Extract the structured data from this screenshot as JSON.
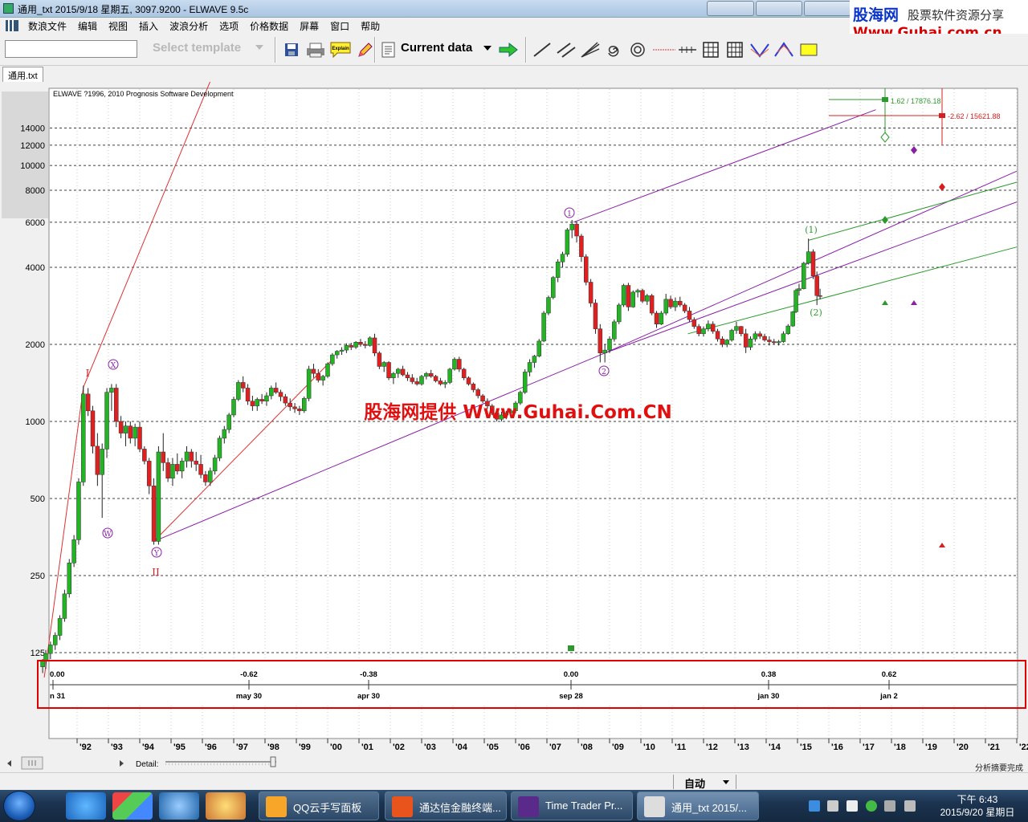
{
  "window": {
    "title": "通用_txt  2015/9/18 星期五, 3097.9200 - ELWAVE 9.5c"
  },
  "promo": {
    "logo": "股海网",
    "slogan": "股票软件资源分享",
    "url": "Www.Guhai.com.cn"
  },
  "menu": [
    "数浪文件",
    "编辑",
    "视图",
    "插入",
    "波浪分析",
    "选项",
    "价格数据",
    "屏幕",
    "窗口",
    "帮助"
  ],
  "toolbar": {
    "search_value": "",
    "template_label": "Select template",
    "explain_label": "Explain",
    "data_label": "Current data"
  },
  "document_tab": "通用.txt",
  "chart_data": {
    "type": "candlestick",
    "title": "ELWAVE ?1996, 2010 Prognosis Software Development",
    "watermark": "股海网提供 Www.Guhai.Com.CN",
    "y_scale": "log",
    "y_ticks": [
      125,
      250,
      500,
      1000,
      2000,
      4000,
      6000,
      8000,
      10000,
      12000,
      14000
    ],
    "x_ticks": [
      "'92",
      "'93",
      "'94",
      "'95",
      "'96",
      "'97",
      "'98",
      "'99",
      "'00",
      "'01",
      "'02",
      "'03",
      "'04",
      "'05",
      "'06",
      "'07",
      "'08",
      "'09",
      "'10",
      "'11",
      "'12",
      "'13",
      "'14",
      "'15",
      "'16",
      "'17",
      "'18",
      "'19",
      "'20",
      "'21",
      "'22"
    ],
    "candles": [
      [
        1990.9,
        110,
        118,
        104,
        116
      ],
      [
        1991.0,
        116,
        128,
        108,
        124
      ],
      [
        1991.15,
        124,
        138,
        118,
        134
      ],
      [
        1991.3,
        134,
        150,
        128,
        146
      ],
      [
        1991.45,
        146,
        175,
        140,
        170
      ],
      [
        1991.6,
        170,
        220,
        165,
        212
      ],
      [
        1991.75,
        212,
        290,
        205,
        280
      ],
      [
        1991.9,
        280,
        360,
        270,
        345
      ],
      [
        1992.05,
        345,
        600,
        330,
        580
      ],
      [
        1992.2,
        580,
        1380,
        560,
        1280
      ],
      [
        1992.35,
        1280,
        1350,
        1050,
        1100
      ],
      [
        1992.5,
        1100,
        1150,
        750,
        800
      ],
      [
        1992.65,
        800,
        900,
        560,
        620
      ],
      [
        1992.8,
        620,
        820,
        420,
        780
      ],
      [
        1992.95,
        780,
        1350,
        720,
        1300
      ],
      [
        1993.1,
        1300,
        1400,
        1100,
        1350
      ],
      [
        1993.25,
        1350,
        1400,
        950,
        1000
      ],
      [
        1993.4,
        1000,
        1050,
        860,
        900
      ],
      [
        1993.55,
        900,
        1000,
        800,
        960
      ],
      [
        1993.7,
        960,
        1000,
        820,
        860
      ],
      [
        1993.85,
        860,
        980,
        800,
        950
      ],
      [
        1994.0,
        950,
        1000,
        760,
        780
      ],
      [
        1994.15,
        780,
        800,
        680,
        700
      ],
      [
        1994.3,
        700,
        720,
        520,
        560
      ],
      [
        1994.45,
        560,
        600,
        330,
        340
      ],
      [
        1994.6,
        340,
        800,
        330,
        760
      ],
      [
        1994.75,
        760,
        900,
        640,
        690
      ],
      [
        1994.9,
        690,
        720,
        580,
        600
      ],
      [
        1995.05,
        600,
        720,
        560,
        680
      ],
      [
        1995.2,
        680,
        750,
        620,
        640
      ],
      [
        1995.35,
        640,
        720,
        600,
        700
      ],
      [
        1995.5,
        700,
        800,
        660,
        760
      ],
      [
        1995.65,
        760,
        780,
        660,
        700
      ],
      [
        1995.8,
        700,
        760,
        640,
        680
      ],
      [
        1995.95,
        680,
        740,
        600,
        620
      ],
      [
        1996.1,
        620,
        640,
        560,
        580
      ],
      [
        1996.25,
        580,
        660,
        560,
        640
      ],
      [
        1996.4,
        640,
        740,
        620,
        720
      ],
      [
        1996.55,
        720,
        880,
        700,
        860
      ],
      [
        1996.7,
        860,
        960,
        820,
        930
      ],
      [
        1996.85,
        930,
        1080,
        900,
        1060
      ],
      [
        1997.0,
        1060,
        1250,
        1040,
        1220
      ],
      [
        1997.15,
        1220,
        1450,
        1200,
        1420
      ],
      [
        1997.3,
        1420,
        1500,
        1300,
        1350
      ],
      [
        1997.45,
        1350,
        1400,
        1160,
        1200
      ],
      [
        1997.6,
        1200,
        1260,
        1100,
        1150
      ],
      [
        1997.75,
        1150,
        1240,
        1100,
        1220
      ],
      [
        1997.9,
        1220,
        1280,
        1170,
        1200
      ],
      [
        1998.05,
        1200,
        1300,
        1150,
        1260
      ],
      [
        1998.2,
        1260,
        1380,
        1220,
        1350
      ],
      [
        1998.35,
        1350,
        1420,
        1280,
        1300
      ],
      [
        1998.5,
        1300,
        1330,
        1200,
        1250
      ],
      [
        1998.65,
        1250,
        1280,
        1150,
        1180
      ],
      [
        1998.8,
        1180,
        1230,
        1100,
        1140
      ],
      [
        1998.95,
        1140,
        1180,
        1080,
        1120
      ],
      [
        1999.1,
        1120,
        1150,
        1060,
        1100
      ],
      [
        1999.25,
        1100,
        1250,
        1080,
        1230
      ],
      [
        1999.4,
        1230,
        1650,
        1200,
        1600
      ],
      [
        1999.55,
        1600,
        1680,
        1480,
        1540
      ],
      [
        1999.7,
        1540,
        1600,
        1420,
        1450
      ],
      [
        1999.85,
        1450,
        1520,
        1380,
        1500
      ],
      [
        2000.0,
        1500,
        1700,
        1480,
        1680
      ],
      [
        2000.15,
        1680,
        1850,
        1650,
        1820
      ],
      [
        2000.3,
        1820,
        1900,
        1760,
        1880
      ],
      [
        2000.45,
        1880,
        1950,
        1820,
        1900
      ],
      [
        2000.6,
        1900,
        2020,
        1850,
        1980
      ],
      [
        2000.75,
        1980,
        2030,
        1900,
        1950
      ],
      [
        2000.9,
        1950,
        2060,
        1920,
        2040
      ],
      [
        2001.05,
        2040,
        2100,
        1960,
        2000
      ],
      [
        2001.2,
        2000,
        2060,
        1930,
        1980
      ],
      [
        2001.35,
        1980,
        2150,
        1960,
        2120
      ],
      [
        2001.5,
        2120,
        2200,
        1800,
        1850
      ],
      [
        2001.65,
        1850,
        1880,
        1600,
        1640
      ],
      [
        2001.8,
        1640,
        1720,
        1560,
        1700
      ],
      [
        2001.95,
        1700,
        1720,
        1450,
        1480
      ],
      [
        2002.1,
        1480,
        1560,
        1400,
        1540
      ],
      [
        2002.25,
        1540,
        1620,
        1480,
        1600
      ],
      [
        2002.4,
        1600,
        1650,
        1500,
        1520
      ],
      [
        2002.55,
        1520,
        1560,
        1440,
        1480
      ],
      [
        2002.7,
        1480,
        1530,
        1400,
        1430
      ],
      [
        2002.85,
        1430,
        1480,
        1380,
        1400
      ],
      [
        2003.0,
        1400,
        1520,
        1380,
        1500
      ],
      [
        2003.15,
        1500,
        1560,
        1460,
        1540
      ],
      [
        2003.3,
        1540,
        1590,
        1480,
        1500
      ],
      [
        2003.45,
        1500,
        1520,
        1420,
        1440
      ],
      [
        2003.6,
        1440,
        1480,
        1380,
        1400
      ],
      [
        2003.75,
        1400,
        1450,
        1350,
        1420
      ],
      [
        2003.9,
        1420,
        1620,
        1400,
        1600
      ],
      [
        2004.05,
        1600,
        1780,
        1580,
        1750
      ],
      [
        2004.2,
        1750,
        1790,
        1560,
        1600
      ],
      [
        2004.35,
        1600,
        1620,
        1450,
        1480
      ],
      [
        2004.5,
        1480,
        1500,
        1380,
        1400
      ],
      [
        2004.65,
        1400,
        1420,
        1300,
        1330
      ],
      [
        2004.8,
        1330,
        1350,
        1230,
        1260
      ],
      [
        2004.95,
        1260,
        1280,
        1180,
        1200
      ],
      [
        2005.1,
        1200,
        1230,
        1120,
        1150
      ],
      [
        2005.25,
        1150,
        1170,
        1060,
        1080
      ],
      [
        2005.4,
        1080,
        1100,
        1000,
        1020
      ],
      [
        2005.55,
        1020,
        1090,
        1000,
        1060
      ],
      [
        2005.7,
        1060,
        1100,
        1020,
        1080
      ],
      [
        2005.85,
        1080,
        1120,
        1050,
        1100
      ],
      [
        2006.0,
        1100,
        1200,
        1080,
        1180
      ],
      [
        2006.15,
        1180,
        1320,
        1160,
        1300
      ],
      [
        2006.3,
        1300,
        1600,
        1280,
        1560
      ],
      [
        2006.45,
        1560,
        1750,
        1500,
        1700
      ],
      [
        2006.6,
        1700,
        1820,
        1620,
        1800
      ],
      [
        2006.75,
        1800,
        2100,
        1780,
        2060
      ],
      [
        2006.9,
        2060,
        2700,
        2040,
        2650
      ],
      [
        2007.05,
        2650,
        3100,
        2600,
        3050
      ],
      [
        2007.2,
        3050,
        3700,
        3000,
        3650
      ],
      [
        2007.35,
        3650,
        4300,
        3500,
        4200
      ],
      [
        2007.5,
        4200,
        4600,
        4000,
        4500
      ],
      [
        2007.65,
        4500,
        5700,
        4400,
        5600
      ],
      [
        2007.8,
        5600,
        6124,
        5200,
        5900
      ],
      [
        2007.95,
        5900,
        6000,
        5000,
        5300
      ],
      [
        2008.1,
        5300,
        5400,
        4200,
        4400
      ],
      [
        2008.25,
        4400,
        4500,
        3400,
        3500
      ],
      [
        2008.4,
        3500,
        3600,
        2800,
        2900
      ],
      [
        2008.55,
        2900,
        3000,
        2200,
        2300
      ],
      [
        2008.7,
        2300,
        2400,
        1700,
        1850
      ],
      [
        2008.85,
        1850,
        2000,
        1700,
        1900
      ],
      [
        2009.0,
        1900,
        2150,
        1850,
        2100
      ],
      [
        2009.15,
        2100,
        2500,
        2050,
        2450
      ],
      [
        2009.3,
        2450,
        2900,
        2400,
        2850
      ],
      [
        2009.45,
        2850,
        3450,
        2800,
        3400
      ],
      [
        2009.6,
        3400,
        3480,
        2700,
        2800
      ],
      [
        2009.75,
        2800,
        3250,
        2780,
        3200
      ],
      [
        2009.9,
        3200,
        3300,
        3050,
        3250
      ],
      [
        2010.05,
        3250,
        3300,
        2900,
        2950
      ],
      [
        2010.2,
        2950,
        3150,
        2850,
        3100
      ],
      [
        2010.35,
        3100,
        3150,
        2600,
        2650
      ],
      [
        2010.5,
        2650,
        2700,
        2320,
        2400
      ],
      [
        2010.65,
        2400,
        2700,
        2380,
        2650
      ],
      [
        2010.8,
        2650,
        3150,
        2600,
        3000
      ],
      [
        2010.95,
        3000,
        3100,
        2750,
        2800
      ],
      [
        2011.1,
        2800,
        3050,
        2700,
        2950
      ],
      [
        2011.25,
        2950,
        3070,
        2800,
        2850
      ],
      [
        2011.4,
        2850,
        2900,
        2650,
        2700
      ],
      [
        2011.55,
        2700,
        2800,
        2450,
        2500
      ],
      [
        2011.7,
        2500,
        2550,
        2300,
        2350
      ],
      [
        2011.85,
        2350,
        2400,
        2150,
        2200
      ],
      [
        2012.0,
        2200,
        2350,
        2150,
        2300
      ],
      [
        2012.15,
        2300,
        2480,
        2250,
        2400
      ],
      [
        2012.3,
        2400,
        2460,
        2200,
        2250
      ],
      [
        2012.45,
        2250,
        2300,
        2050,
        2100
      ],
      [
        2012.6,
        2100,
        2150,
        1950,
        2000
      ],
      [
        2012.75,
        2000,
        2100,
        1950,
        2080
      ],
      [
        2012.9,
        2080,
        2300,
        2050,
        2270
      ],
      [
        2013.05,
        2270,
        2450,
        2200,
        2350
      ],
      [
        2013.2,
        2350,
        2360,
        2150,
        2200
      ],
      [
        2013.35,
        2200,
        2300,
        1850,
        1950
      ],
      [
        2013.5,
        1950,
        2150,
        1900,
        2100
      ],
      [
        2013.65,
        2100,
        2250,
        2050,
        2200
      ],
      [
        2013.8,
        2200,
        2250,
        2100,
        2150
      ],
      [
        2013.95,
        2150,
        2200,
        2050,
        2080
      ],
      [
        2014.1,
        2080,
        2150,
        1980,
        2050
      ],
      [
        2014.25,
        2050,
        2100,
        2000,
        2030
      ],
      [
        2014.4,
        2030,
        2080,
        1980,
        2050
      ],
      [
        2014.55,
        2050,
        2250,
        2030,
        2200
      ],
      [
        2014.7,
        2200,
        2400,
        2180,
        2360
      ],
      [
        2014.85,
        2360,
        2700,
        2340,
        2680
      ],
      [
        2014.95,
        2680,
        3300,
        2650,
        3250
      ],
      [
        2015.05,
        3250,
        3450,
        3100,
        3300
      ],
      [
        2015.2,
        3300,
        4200,
        3280,
        4150
      ],
      [
        2015.35,
        4150,
        5178,
        4100,
        4600
      ],
      [
        2015.5,
        4600,
        4700,
        3600,
        3700
      ],
      [
        2015.62,
        3700,
        3850,
        2850,
        3100
      ],
      [
        2015.72,
        3100,
        3300,
        3000,
        3098
      ]
    ]
  },
  "wave_labels": {
    "I": "I",
    "II": "II",
    "W": "W",
    "X": "X",
    "Y": "Y",
    "w1": "1",
    "w2": "2",
    "w1b": "(1)",
    "w2b": "(2)",
    "base": "II"
  },
  "targets": {
    "green": "1.62 / 17876.18",
    "red": "-2.62 / 15621.88"
  },
  "time_panel": {
    "ratios": [
      "0.00",
      "-0.62",
      "-0.38",
      "0.00",
      "0.38",
      "0.62"
    ],
    "dates": [
      "n 31",
      "may 30",
      "apr 30",
      "sep 28",
      "jan 30",
      "jan 2"
    ]
  },
  "scrollbar": {
    "detail_label": "Detail:"
  },
  "status": {
    "mode": "自动",
    "info": "分析摘要完成"
  },
  "taskbar": {
    "tasks": [
      "QQ云手写面板",
      "通达信金融终端...",
      "Time Trader Pr...",
      "通用_txt   2015/..."
    ],
    "time": "下午 6:43",
    "date": "2015/9/20 星期日"
  },
  "colors": {
    "up": "#22b422",
    "down": "#e02020",
    "purple": "#8a1fa8",
    "green_line": "#2a9a2a",
    "red_line": "#e03030"
  }
}
